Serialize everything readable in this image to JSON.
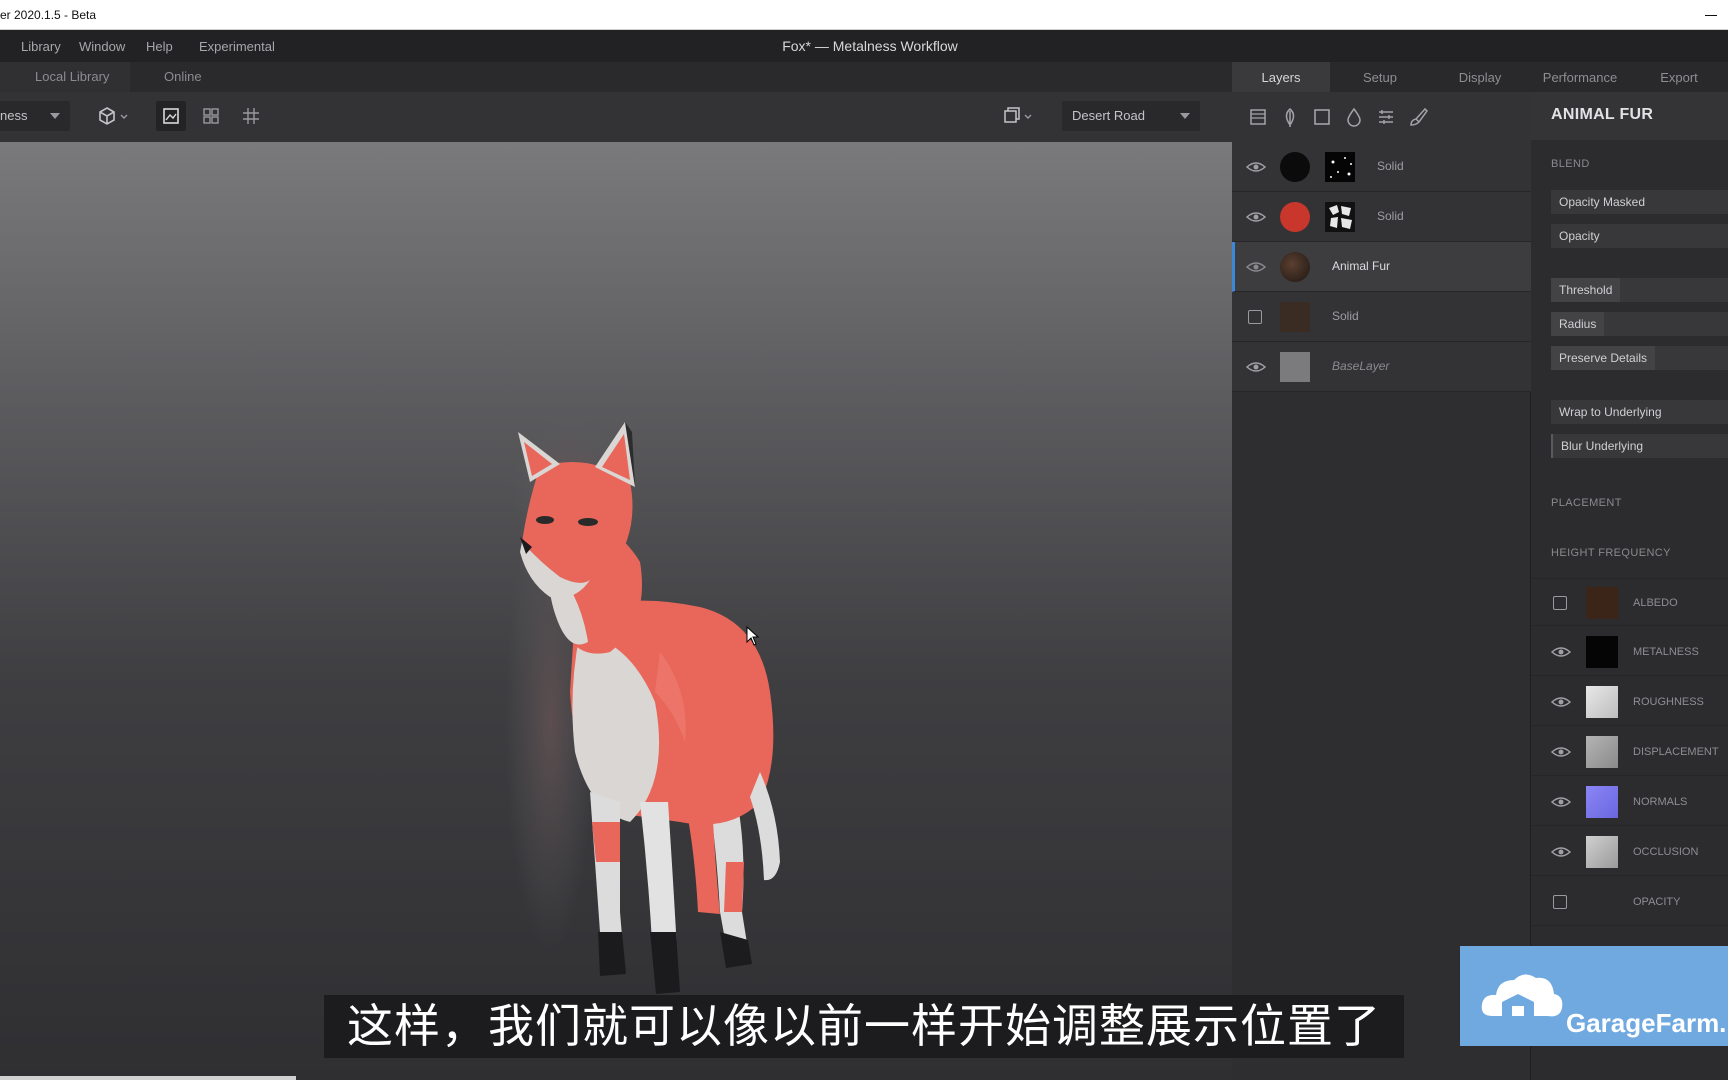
{
  "window": {
    "title": "er 2020.1.5 - Beta"
  },
  "menu": {
    "items": [
      "Library",
      "Window",
      "Help",
      "Experimental"
    ],
    "document_title": "Fox* — Metalness Workflow"
  },
  "library_tabs": [
    "Local Library",
    "Online"
  ],
  "viewport_toolbar": {
    "workflow_dropdown": "ness",
    "environment_dropdown": "Desert Road"
  },
  "right_tabs": [
    "Layers",
    "Setup",
    "Display",
    "Performance",
    "Export"
  ],
  "layers": [
    {
      "name": "Solid",
      "visible": true,
      "color": "#0b0b0b",
      "has_mask": true,
      "style": "dim"
    },
    {
      "name": "Solid",
      "visible": true,
      "color": "#c8362c",
      "has_mask": true,
      "style": "dim"
    },
    {
      "name": "Animal Fur",
      "visible": true,
      "color": "#3a2a22",
      "has_mask": false,
      "style": "selected"
    },
    {
      "name": "Solid",
      "visible": false,
      "color": "#3a2c22",
      "has_mask": false,
      "style": "dim"
    },
    {
      "name": "BaseLayer",
      "visible": true,
      "color": "#7b7b7e",
      "has_mask": false,
      "style": "italic"
    }
  ],
  "properties": {
    "title": "ANIMAL FUR",
    "blend": {
      "section": "BLEND",
      "mode": "Opacity Masked",
      "opacity": "Opacity",
      "threshold": "Threshold",
      "radius": "Radius",
      "preserve_details": "Preserve Details",
      "wrap": "Wrap to Underlying",
      "blur": "Blur Underlying"
    },
    "placement_section": "PLACEMENT",
    "height_section": "HEIGHT FREQUENCY",
    "channels": [
      {
        "label": "ALBEDO",
        "visible": false,
        "color": "#3a2518"
      },
      {
        "label": "METALNESS",
        "visible": true,
        "color": "#050505"
      },
      {
        "label": "ROUGHNESS",
        "visible": true,
        "color": "#d8d8d8"
      },
      {
        "label": "DISPLACEMENT",
        "visible": true,
        "color": "#a8a8a8"
      },
      {
        "label": "NORMALS",
        "visible": true,
        "color": "#7b78ee"
      },
      {
        "label": "OCCLUSION",
        "visible": true,
        "color": "#bdbdbd"
      },
      {
        "label": "OPACITY",
        "visible": false,
        "color": "#2c2c2f"
      }
    ]
  },
  "subtitle": "这样，我们就可以像以前一样开始调整展示位置了",
  "watermark": {
    "text": "GarageFarm.N"
  },
  "colors": {
    "accent": "#3d87d8",
    "fox_fur": "#e8675a",
    "watermark_bg": "#6fa9df"
  }
}
